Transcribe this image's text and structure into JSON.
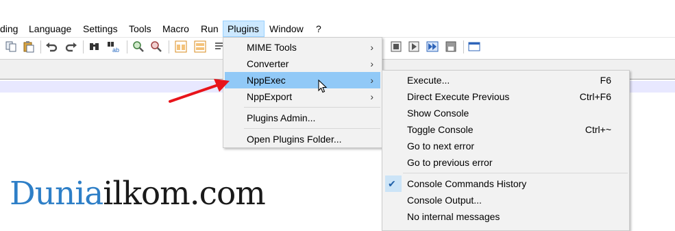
{
  "menubar": {
    "items": [
      {
        "label": "ding"
      },
      {
        "label": "Language"
      },
      {
        "label": "Settings"
      },
      {
        "label": "Tools"
      },
      {
        "label": "Macro"
      },
      {
        "label": "Run"
      },
      {
        "label": "Plugins"
      },
      {
        "label": "Window"
      },
      {
        "label": "?"
      }
    ]
  },
  "plugins_menu": {
    "items": [
      {
        "label": "MIME Tools",
        "submenu_arrow": "›"
      },
      {
        "label": "Converter",
        "submenu_arrow": "›"
      },
      {
        "label": "NppExec",
        "submenu_arrow": "›"
      },
      {
        "label": "NppExport",
        "submenu_arrow": "›"
      },
      {
        "label": "Plugins Admin..."
      },
      {
        "label": "Open Plugins Folder..."
      }
    ]
  },
  "nppexec_menu": {
    "items": [
      {
        "label": "Execute...",
        "shortcut": "F6"
      },
      {
        "label": "Direct Execute Previous",
        "shortcut": "Ctrl+F6"
      },
      {
        "label": "Show Console",
        "shortcut": ""
      },
      {
        "label": "Toggle Console",
        "shortcut": "Ctrl+~"
      },
      {
        "label": "Go to next error",
        "shortcut": ""
      },
      {
        "label": "Go to previous error",
        "shortcut": ""
      },
      {
        "label": "Console Commands History",
        "checked": true,
        "check_glyph": "✔"
      },
      {
        "label": "Console Output...",
        "shortcut": ""
      },
      {
        "label": "No internal messages",
        "shortcut": ""
      }
    ]
  },
  "watermark": {
    "part1": "Dunia",
    "part2": "ilkom",
    "part3": ".com"
  },
  "colors": {
    "highlight": "#91c9f7",
    "menubar_active": "#cce8ff",
    "arrow_red": "#e8141b",
    "watermark_blue": "#2e7fc7"
  },
  "icons": [
    "copy-icon",
    "paste-icon",
    "undo-icon",
    "redo-icon",
    "find-icon",
    "replace-icon",
    "zoom-in-icon",
    "zoom-out-icon",
    "sync-v-icon",
    "sync-h-icon",
    "wrap-icon",
    "stop-record-icon",
    "play-macro-icon",
    "run-macro-multiple-icon",
    "save-macro-icon",
    "console-icon"
  ]
}
